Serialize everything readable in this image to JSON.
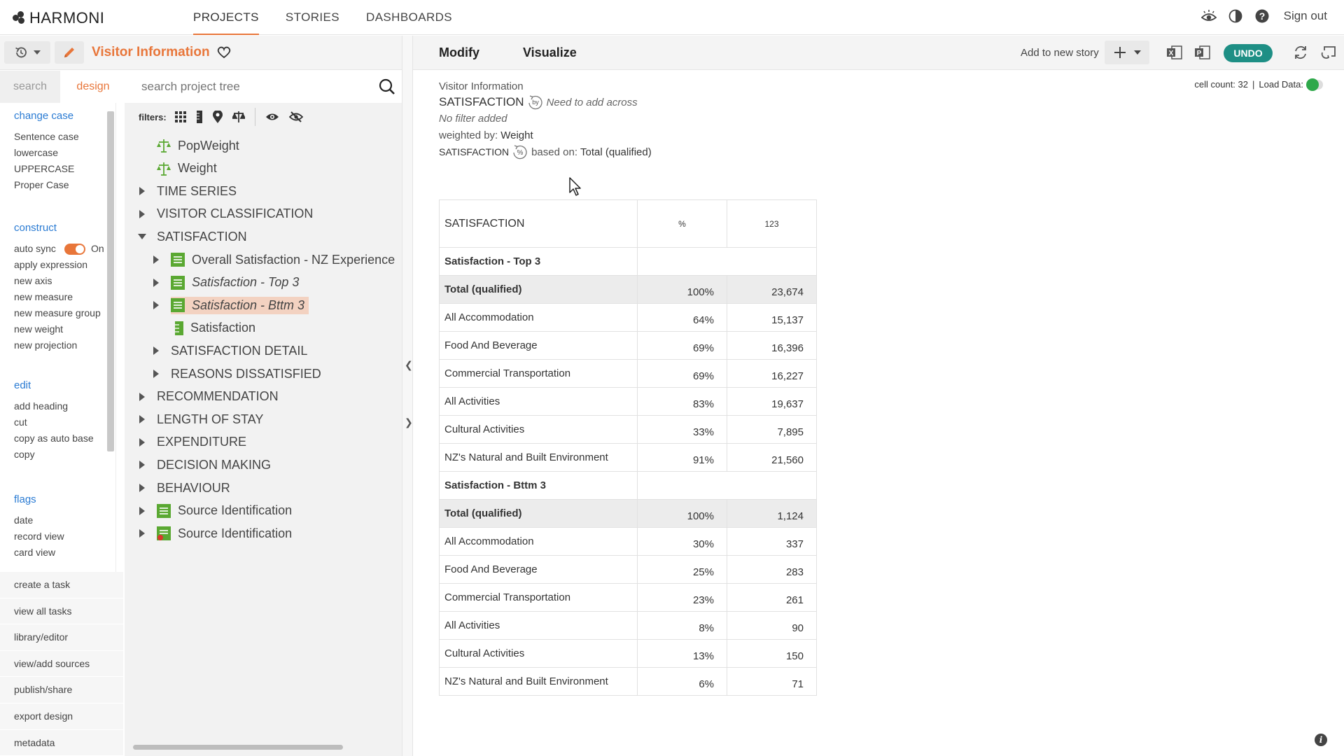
{
  "app": {
    "logo": "HARMONI"
  },
  "nav": {
    "items": [
      "PROJECTS",
      "STORIES",
      "DASHBOARDS"
    ],
    "active": "PROJECTS",
    "signout": "Sign out"
  },
  "project": {
    "title": "Visitor Information"
  },
  "left_tabs": {
    "search": "search",
    "design": "design"
  },
  "tree_search": {
    "placeholder": "search project tree"
  },
  "actions": {
    "change_case": {
      "head": "change case",
      "items": [
        "Sentence case",
        "lowercase",
        "UPPERCASE",
        "Proper Case"
      ]
    },
    "construct": {
      "head": "construct",
      "auto_sync": "auto sync",
      "auto_sync_state": "On",
      "items": [
        "apply expression",
        "new axis",
        "new measure",
        "new measure group",
        "new weight",
        "new projection"
      ]
    },
    "edit": {
      "head": "edit",
      "items": [
        "add heading",
        "cut",
        "copy as auto base",
        "copy"
      ]
    },
    "flags": {
      "head": "flags",
      "items": [
        "date",
        "record view",
        "card view"
      ]
    },
    "lower": [
      "create a task",
      "view all tasks",
      "library/editor",
      "view/add sources",
      "publish/share",
      "export design",
      "metadata"
    ]
  },
  "filters_label": "filters:",
  "tree": [
    {
      "label": "PopWeight",
      "caret": "none",
      "icon": "weight",
      "italic": false
    },
    {
      "label": "Weight",
      "caret": "none",
      "icon": "weight",
      "italic": false
    },
    {
      "label": "TIME SERIES",
      "caret": "right",
      "icon": "",
      "italic": false
    },
    {
      "label": "VISITOR CLASSIFICATION",
      "caret": "right",
      "icon": "",
      "italic": false
    },
    {
      "label": "SATISFACTION",
      "caret": "down",
      "icon": "",
      "italic": false
    },
    {
      "label": "Overall Satisfaction - NZ Experience",
      "caret": "right",
      "icon": "list-green",
      "italic": false
    },
    {
      "label": "Satisfaction - Top 3",
      "caret": "right",
      "icon": "list-green",
      "italic": true
    },
    {
      "label": "Satisfaction - Bttm 3",
      "caret": "right",
      "icon": "list-green",
      "italic": true,
      "selected": true
    },
    {
      "label": "Satisfaction",
      "caret": "none",
      "icon": "ruler-green",
      "italic": false
    },
    {
      "label": "SATISFACTION DETAIL",
      "caret": "right",
      "icon": "",
      "italic": false
    },
    {
      "label": "REASONS DISSATISFIED",
      "caret": "right",
      "icon": "",
      "italic": false
    },
    {
      "label": "RECOMMENDATION",
      "caret": "right",
      "icon": "",
      "italic": false
    },
    {
      "label": "LENGTH OF STAY",
      "caret": "right",
      "icon": "",
      "italic": false
    },
    {
      "label": "EXPENDITURE",
      "caret": "right",
      "icon": "",
      "italic": false
    },
    {
      "label": "DECISION MAKING",
      "caret": "right",
      "icon": "",
      "italic": false
    },
    {
      "label": "BEHAVIOUR",
      "caret": "right",
      "icon": "",
      "italic": false
    },
    {
      "label": "Source Identification",
      "caret": "right",
      "icon": "list-green",
      "italic": false
    },
    {
      "label": "Source Identification",
      "caret": "right",
      "icon": "list-green-red",
      "italic": false
    }
  ],
  "main": {
    "tabs": [
      "Modify",
      "Visualize"
    ],
    "add_to_story": "Add to new story",
    "undo": "UNDO",
    "cell_count": "cell count: 32",
    "load_data": "Load Data:",
    "meta": {
      "source": "Visitor Information",
      "measure": "SATISFACTION",
      "by_note": "Need to add across",
      "filter": "No filter added",
      "weighted_label": "weighted by:",
      "weighted_value": "Weight",
      "base_measure": "SATISFACTION",
      "based_on_label": "based on:",
      "based_on_value": "Total (qualified)"
    }
  },
  "table": {
    "header": {
      "title": "SATISFACTION",
      "col_pct": "%",
      "col_num": "123"
    },
    "rows": [
      {
        "kind": "group",
        "label": "Satisfaction - Top 3",
        "pct": "",
        "num": ""
      },
      {
        "kind": "total",
        "label": "Total (qualified)",
        "pct": "100%",
        "num": "23,674"
      },
      {
        "kind": "row",
        "label": "All Accommodation",
        "pct": "64%",
        "num": "15,137"
      },
      {
        "kind": "row",
        "label": "Food And Beverage",
        "pct": "69%",
        "num": "16,396"
      },
      {
        "kind": "row",
        "label": "Commercial Transportation",
        "pct": "69%",
        "num": "16,227"
      },
      {
        "kind": "row",
        "label": "All Activities",
        "pct": "83%",
        "num": "19,637"
      },
      {
        "kind": "row",
        "label": "Cultural Activities",
        "pct": "33%",
        "num": "7,895"
      },
      {
        "kind": "row",
        "label": "NZ's Natural and Built Environment",
        "pct": "91%",
        "num": "21,560"
      },
      {
        "kind": "group",
        "label": "Satisfaction - Bttm 3",
        "pct": "",
        "num": ""
      },
      {
        "kind": "total",
        "label": "Total (qualified)",
        "pct": "100%",
        "num": "1,124"
      },
      {
        "kind": "row",
        "label": "All Accommodation",
        "pct": "30%",
        "num": "337"
      },
      {
        "kind": "row",
        "label": "Food And Beverage",
        "pct": "25%",
        "num": "283"
      },
      {
        "kind": "row",
        "label": "Commercial Transportation",
        "pct": "23%",
        "num": "261"
      },
      {
        "kind": "row",
        "label": "All Activities",
        "pct": "8%",
        "num": "90"
      },
      {
        "kind": "row",
        "label": "Cultural Activities",
        "pct": "13%",
        "num": "150"
      },
      {
        "kind": "row",
        "label": "NZ's Natural and Built Environment",
        "pct": "6%",
        "num": "71"
      }
    ]
  },
  "colors": {
    "accent": "#e8763a",
    "link": "#2a7bd3",
    "undo": "#1e8f85",
    "green_icon": "#5aa832",
    "load_on": "#2ea84a"
  }
}
